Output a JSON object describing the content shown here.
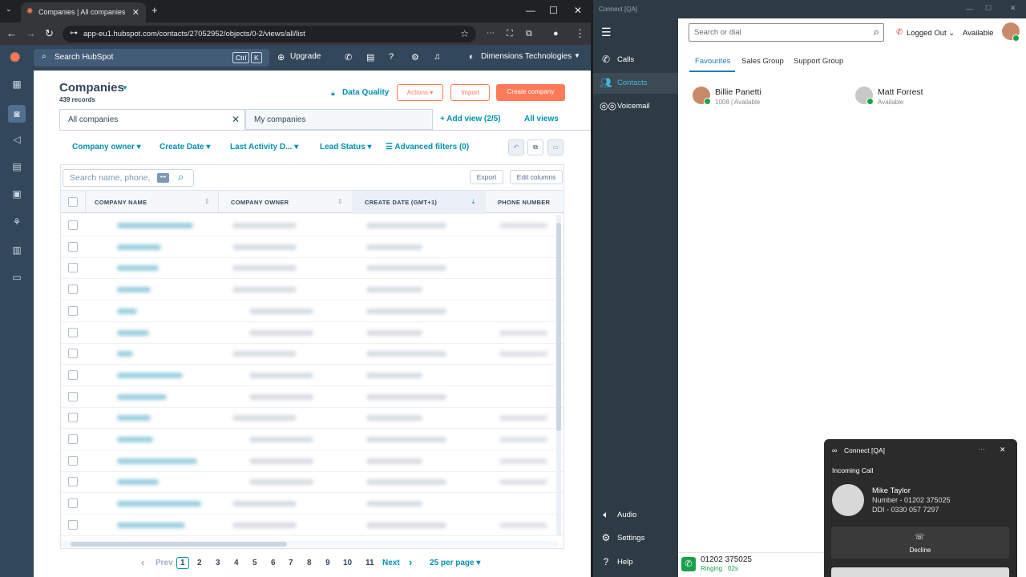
{
  "browser": {
    "tab_title": "Companies | All companies",
    "url": "app-eu1.hubspot.com/contacts/27052952/objects/0-2/views/all/list"
  },
  "hubspot_nav": {
    "search_placeholder": "Search HubSpot",
    "kbd_ctrl": "Ctrl",
    "kbd_k": "K",
    "upgrade": "Upgrade",
    "account": "Dimensions Technologies"
  },
  "page": {
    "title": "Companies",
    "record_count": "439 records",
    "data_quality": "Data Quality",
    "actions": "Actions",
    "import": "Import",
    "create": "Create company",
    "view_tabs": [
      "All companies",
      "My companies"
    ],
    "add_view": "Add view (2/5)",
    "all_views": "All views",
    "filters": [
      "Company owner",
      "Create Date",
      "Last Activity D...",
      "Lead Status"
    ],
    "advanced_filters": "Advanced filters (0)",
    "search_placeholder": "Search name, phone,",
    "export": "Export",
    "edit_columns": "Edit columns",
    "columns": [
      "COMPANY NAME",
      "COMPANY OWNER",
      "CREATE DATE (GMT+1)",
      "PHONE NUMBER"
    ],
    "pager": {
      "prev": "Prev",
      "pages": [
        "1",
        "2",
        "3",
        "4",
        "5",
        "6",
        "7",
        "8",
        "9",
        "10",
        "11"
      ],
      "next": "Next",
      "per_page": "25 per page"
    }
  },
  "connect": {
    "window_title": "Connect [QA]",
    "nav": [
      "Calls",
      "Contacts",
      "Voicemail"
    ],
    "bottom_nav": [
      "Audio",
      "Settings",
      "Help"
    ],
    "search_placeholder": "Search or dial",
    "logged_out": "Logged Out",
    "available": "Available",
    "tabs": [
      "Favourites",
      "Sales Group",
      "Support Group"
    ],
    "contacts": [
      {
        "name": "Billie Panetti",
        "status": "1008 | Available"
      },
      {
        "name": "Matt Forrest",
        "status": "Available"
      }
    ],
    "status_number": "01202 375025",
    "status_state": "Ringing",
    "status_time": "02s"
  },
  "popup": {
    "title": "Connect [QA]",
    "heading": "Incoming Call",
    "caller": "Mike Taylor",
    "number": "Number - 01202 375025",
    "ddi": "DDI - 0330 057 7297",
    "decline": "Decline"
  },
  "colors": {
    "accent": "#ff7a59",
    "link": "#0091ae",
    "nav": "#33475b",
    "connect_side": "#2f3b44"
  }
}
